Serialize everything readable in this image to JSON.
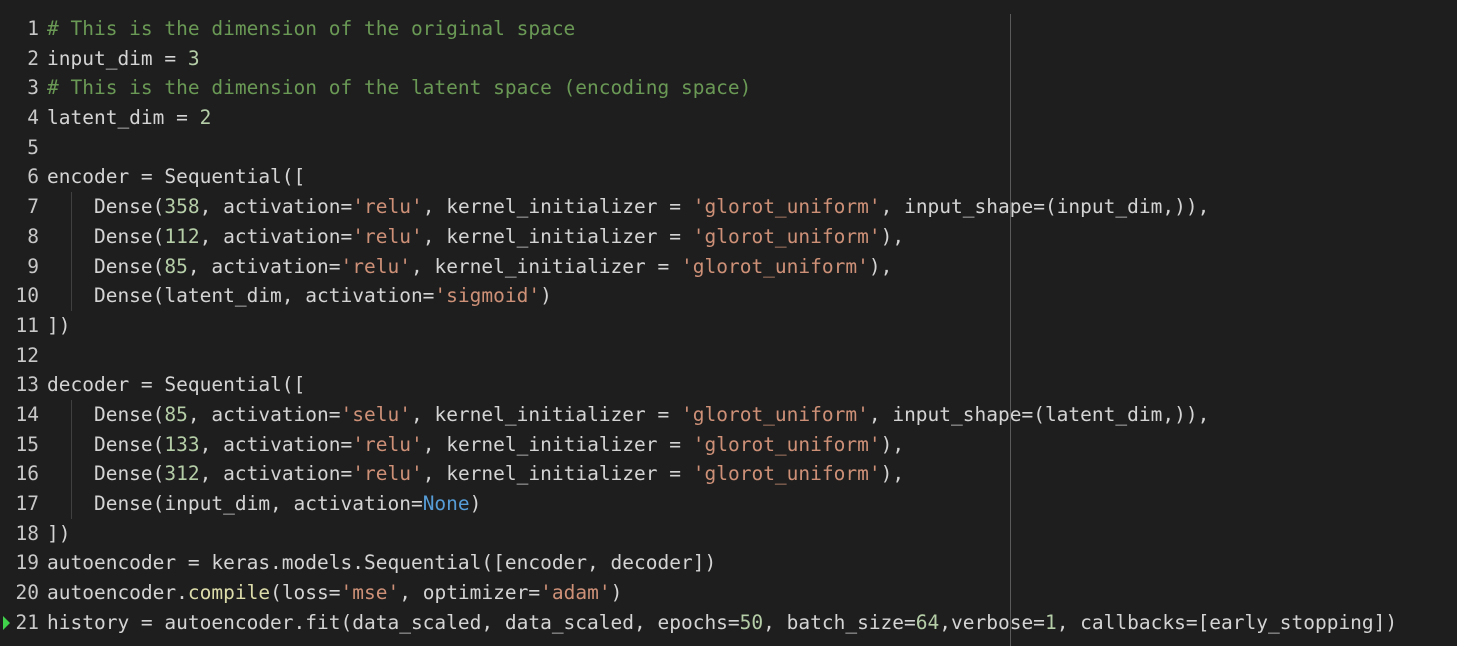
{
  "editor": {
    "colors": {
      "background": "#1e1e1e",
      "comment": "#6a9955",
      "string": "#ce9178",
      "number": "#b5cea8",
      "builtin": "#569cd6",
      "function": "#dcdcaa",
      "default": "#d4d4d4",
      "exec_marker": "#3fd24a"
    },
    "lines": [
      {
        "num": "1",
        "tokens": [
          {
            "t": "comment",
            "v": "# This is the dimension of the original space"
          }
        ]
      },
      {
        "num": "2",
        "tokens": [
          {
            "t": "default",
            "v": "input_dim = "
          },
          {
            "t": "number",
            "v": "3"
          }
        ]
      },
      {
        "num": "3",
        "tokens": [
          {
            "t": "comment",
            "v": "# This is the dimension of the latent space (encoding space)"
          }
        ]
      },
      {
        "num": "4",
        "tokens": [
          {
            "t": "default",
            "v": "latent_dim = "
          },
          {
            "t": "number",
            "v": "2"
          }
        ]
      },
      {
        "num": "5",
        "tokens": []
      },
      {
        "num": "6",
        "tokens": [
          {
            "t": "default",
            "v": "encoder = Sequential(["
          }
        ]
      },
      {
        "num": "7",
        "indent": true,
        "tokens": [
          {
            "t": "default",
            "v": "    Dense("
          },
          {
            "t": "number",
            "v": "358"
          },
          {
            "t": "default",
            "v": ", activation="
          },
          {
            "t": "string",
            "v": "'relu'"
          },
          {
            "t": "default",
            "v": ", kernel_initializer = "
          },
          {
            "t": "string",
            "v": "'glorot_uniform'"
          },
          {
            "t": "default",
            "v": ", input_shape=(input_dim,)),"
          }
        ]
      },
      {
        "num": "8",
        "indent": true,
        "tokens": [
          {
            "t": "default",
            "v": "    Dense("
          },
          {
            "t": "number",
            "v": "112"
          },
          {
            "t": "default",
            "v": ", activation="
          },
          {
            "t": "string",
            "v": "'relu'"
          },
          {
            "t": "default",
            "v": ", kernel_initializer = "
          },
          {
            "t": "string",
            "v": "'glorot_uniform'"
          },
          {
            "t": "default",
            "v": "),"
          }
        ]
      },
      {
        "num": "9",
        "indent": true,
        "tokens": [
          {
            "t": "default",
            "v": "    Dense("
          },
          {
            "t": "number",
            "v": "85"
          },
          {
            "t": "default",
            "v": ", activation="
          },
          {
            "t": "string",
            "v": "'relu'"
          },
          {
            "t": "default",
            "v": ", kernel_initializer = "
          },
          {
            "t": "string",
            "v": "'glorot_uniform'"
          },
          {
            "t": "default",
            "v": "),"
          }
        ]
      },
      {
        "num": "10",
        "indent": true,
        "tokens": [
          {
            "t": "default",
            "v": "    Dense(latent_dim, activation="
          },
          {
            "t": "string",
            "v": "'sigmoid'"
          },
          {
            "t": "default",
            "v": ")"
          }
        ]
      },
      {
        "num": "11",
        "tokens": [
          {
            "t": "default",
            "v": "])"
          }
        ]
      },
      {
        "num": "12",
        "tokens": []
      },
      {
        "num": "13",
        "tokens": [
          {
            "t": "default",
            "v": "decoder = Sequential(["
          }
        ]
      },
      {
        "num": "14",
        "indent": true,
        "tokens": [
          {
            "t": "default",
            "v": "    Dense("
          },
          {
            "t": "number",
            "v": "85"
          },
          {
            "t": "default",
            "v": ", activation="
          },
          {
            "t": "string",
            "v": "'selu'"
          },
          {
            "t": "default",
            "v": ", kernel_initializer = "
          },
          {
            "t": "string",
            "v": "'glorot_uniform'"
          },
          {
            "t": "default",
            "v": ", input_shape=(latent_dim,)),"
          }
        ]
      },
      {
        "num": "15",
        "indent": true,
        "tokens": [
          {
            "t": "default",
            "v": "    Dense("
          },
          {
            "t": "number",
            "v": "133"
          },
          {
            "t": "default",
            "v": ", activation="
          },
          {
            "t": "string",
            "v": "'relu'"
          },
          {
            "t": "default",
            "v": ", kernel_initializer = "
          },
          {
            "t": "string",
            "v": "'glorot_uniform'"
          },
          {
            "t": "default",
            "v": "),"
          }
        ]
      },
      {
        "num": "16",
        "indent": true,
        "tokens": [
          {
            "t": "default",
            "v": "    Dense("
          },
          {
            "t": "number",
            "v": "312"
          },
          {
            "t": "default",
            "v": ", activation="
          },
          {
            "t": "string",
            "v": "'relu'"
          },
          {
            "t": "default",
            "v": ", kernel_initializer = "
          },
          {
            "t": "string",
            "v": "'glorot_uniform'"
          },
          {
            "t": "default",
            "v": "),"
          }
        ]
      },
      {
        "num": "17",
        "indent": true,
        "tokens": [
          {
            "t": "default",
            "v": "    Dense(input_dim, activation="
          },
          {
            "t": "builtin",
            "v": "None"
          },
          {
            "t": "default",
            "v": ")"
          }
        ]
      },
      {
        "num": "18",
        "tokens": [
          {
            "t": "default",
            "v": "])"
          }
        ]
      },
      {
        "num": "19",
        "tokens": [
          {
            "t": "default",
            "v": "autoencoder = keras.models.Sequential([encoder, decoder])"
          }
        ]
      },
      {
        "num": "20",
        "tokens": [
          {
            "t": "default",
            "v": "autoencoder."
          },
          {
            "t": "func",
            "v": "compile"
          },
          {
            "t": "default",
            "v": "(loss="
          },
          {
            "t": "string",
            "v": "'mse'"
          },
          {
            "t": "default",
            "v": ", optimizer="
          },
          {
            "t": "string",
            "v": "'adam'"
          },
          {
            "t": "default",
            "v": ")"
          }
        ]
      },
      {
        "num": "21",
        "exec": true,
        "tokens": [
          {
            "t": "default",
            "v": "history = autoencoder.fit(data_scaled, data_scaled, epochs="
          },
          {
            "t": "number",
            "v": "50"
          },
          {
            "t": "default",
            "v": ", batch_size="
          },
          {
            "t": "number",
            "v": "64"
          },
          {
            "t": "default",
            "v": ",verbose="
          },
          {
            "t": "number",
            "v": "1"
          },
          {
            "t": "default",
            "v": ", callbacks=[early_stopping])"
          }
        ]
      }
    ]
  }
}
